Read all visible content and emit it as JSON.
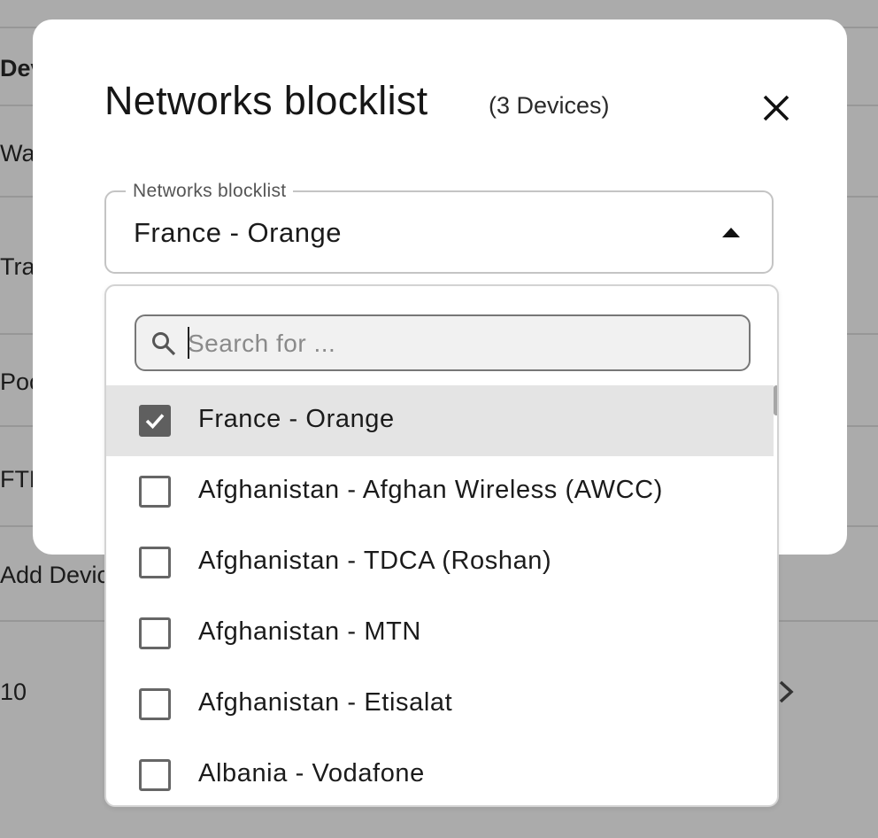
{
  "background": {
    "header_partial": "Dev",
    "rows": [
      "Wal",
      "Trav",
      "Poc",
      "FTM",
      "Add Devic"
    ],
    "pagination_value": "10",
    "icons": {
      "next": "chevron-right-icon"
    }
  },
  "modal": {
    "title": "Networks blocklist",
    "subtitle": "(3 Devices)",
    "close_icon": "close-icon",
    "field": {
      "label": "Networks blocklist",
      "value": "France - Orange",
      "arrow_icon": "arrow-up-icon"
    },
    "dropdown": {
      "search": {
        "placeholder": "Search for ...",
        "value": "",
        "icon": "search-icon"
      },
      "options": [
        {
          "label": "France - Orange",
          "checked": true
        },
        {
          "label": "Afghanistan - Afghan Wireless (AWCC)",
          "checked": false
        },
        {
          "label": "Afghanistan - TDCA (Roshan)",
          "checked": false
        },
        {
          "label": "Afghanistan - MTN",
          "checked": false
        },
        {
          "label": "Afghanistan - Etisalat",
          "checked": false
        },
        {
          "label": "Albania - Vodafone",
          "checked": false
        }
      ]
    }
  },
  "colors": {
    "overlay": "#ababab",
    "selected_row": "#e4e4e4",
    "checkbox_checked": "#5f5f5f"
  }
}
